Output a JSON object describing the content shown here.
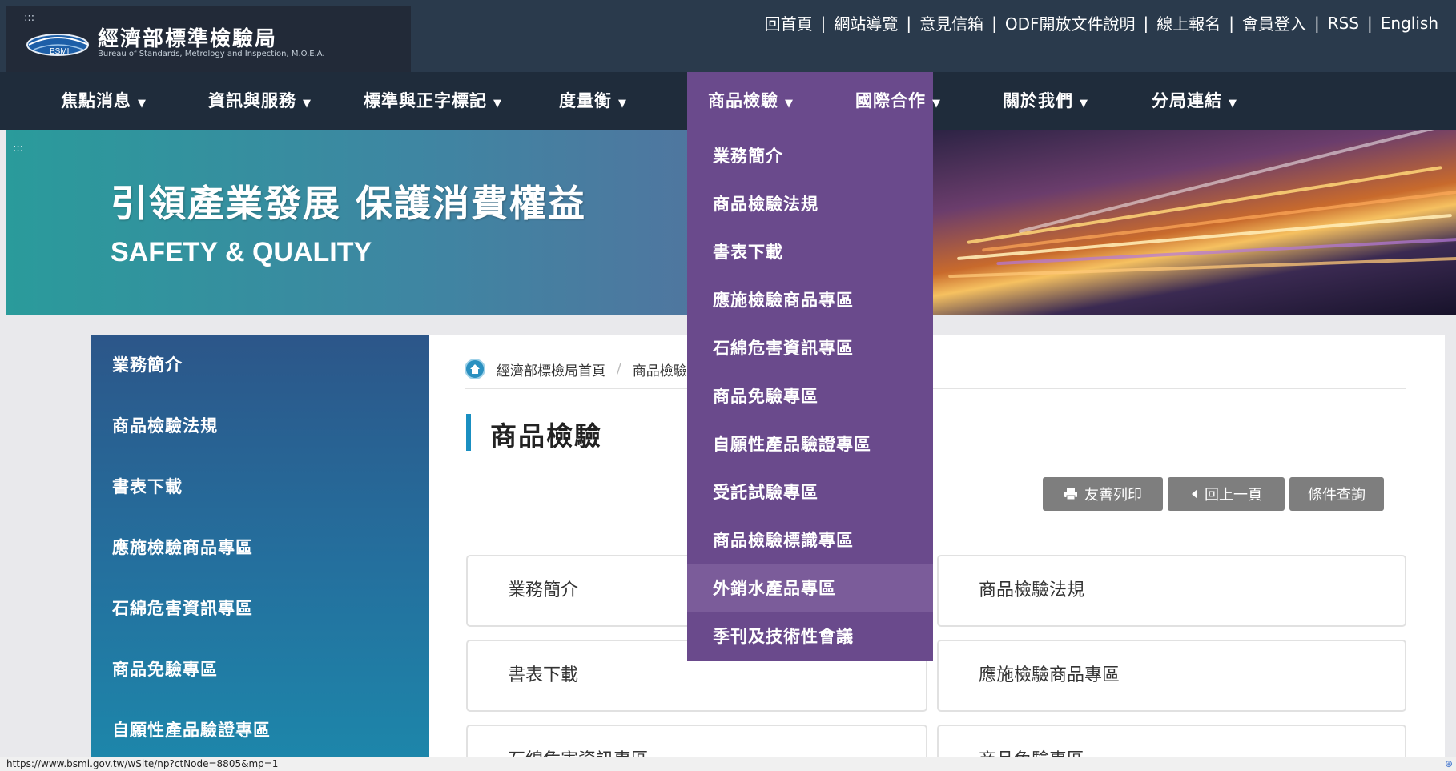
{
  "header": {
    "access_top": ":::",
    "logo_text_zh": "經濟部標準檢驗局",
    "logo_text_en": "Bureau of Standards, Metrology and Inspection, M.O.E.A.",
    "logo_badge": "BSMI",
    "links": [
      {
        "label": "回首頁"
      },
      {
        "label": "網站導覽"
      },
      {
        "label": "意見信箱"
      },
      {
        "label": "ODF開放文件說明"
      },
      {
        "label": "線上報名"
      },
      {
        "label": "會員登入"
      },
      {
        "label": "RSS"
      },
      {
        "label": "English"
      }
    ],
    "separator": "|"
  },
  "nav": {
    "items": [
      {
        "label": "焦點消息"
      },
      {
        "label": "資訊與服務"
      },
      {
        "label": "標準與正字標記"
      },
      {
        "label": "度量衡"
      },
      {
        "label": "商品檢驗"
      },
      {
        "label": "國際合作"
      },
      {
        "label": "關於我們"
      },
      {
        "label": "分局連結"
      }
    ],
    "caret": "▼",
    "active_index": 4
  },
  "banner": {
    "access_center": ":::",
    "title": "引領產業發展 保護消費權益",
    "subtitle": "SAFETY & QUALITY"
  },
  "dropdown": {
    "items": [
      {
        "label": "業務簡介"
      },
      {
        "label": "商品檢驗法規"
      },
      {
        "label": "書表下載"
      },
      {
        "label": "應施檢驗商品專區"
      },
      {
        "label": "石綿危害資訊專區"
      },
      {
        "label": "商品免驗專區"
      },
      {
        "label": "自願性產品驗證專區"
      },
      {
        "label": "受託試驗專區"
      },
      {
        "label": "商品檢驗標識專區"
      },
      {
        "label": "外銷水產品專區"
      },
      {
        "label": "季刊及技術性會議"
      }
    ],
    "hover_index": 9
  },
  "sidebar": {
    "items": [
      {
        "label": "業務簡介"
      },
      {
        "label": "商品檢驗法規"
      },
      {
        "label": "書表下載"
      },
      {
        "label": "應施檢驗商品專區"
      },
      {
        "label": "石綿危害資訊專區"
      },
      {
        "label": "商品免驗專區"
      },
      {
        "label": "自願性產品驗證專區"
      }
    ]
  },
  "breadcrumb": {
    "home": "經濟部標檢局首頁",
    "sep": "/",
    "current": "商品檢驗"
  },
  "page": {
    "title": "商品檢驗",
    "print_label": "友善列印",
    "back_label": "回上一頁",
    "query_label": "條件查詢"
  },
  "cards": [
    {
      "label": "業務簡介"
    },
    {
      "label": "商品檢驗法規"
    },
    {
      "label": "書表下載"
    },
    {
      "label": "應施檢驗商品專區"
    },
    {
      "label": "石綿危害資訊專區"
    },
    {
      "label": "商品免驗專區"
    }
  ],
  "statusbar": {
    "url": "https://www.bsmi.gov.tw/wSite/np?ctNode=8805&mp=1"
  },
  "colors": {
    "header_bg": "#2a3a4c",
    "nav_bg": "#1f2c3b",
    "accent_purple": "#6a4a8c",
    "sidebar_top": "#2c5689",
    "sidebar_bottom": "#1d86aa",
    "title_bar": "#1a8fc1"
  }
}
